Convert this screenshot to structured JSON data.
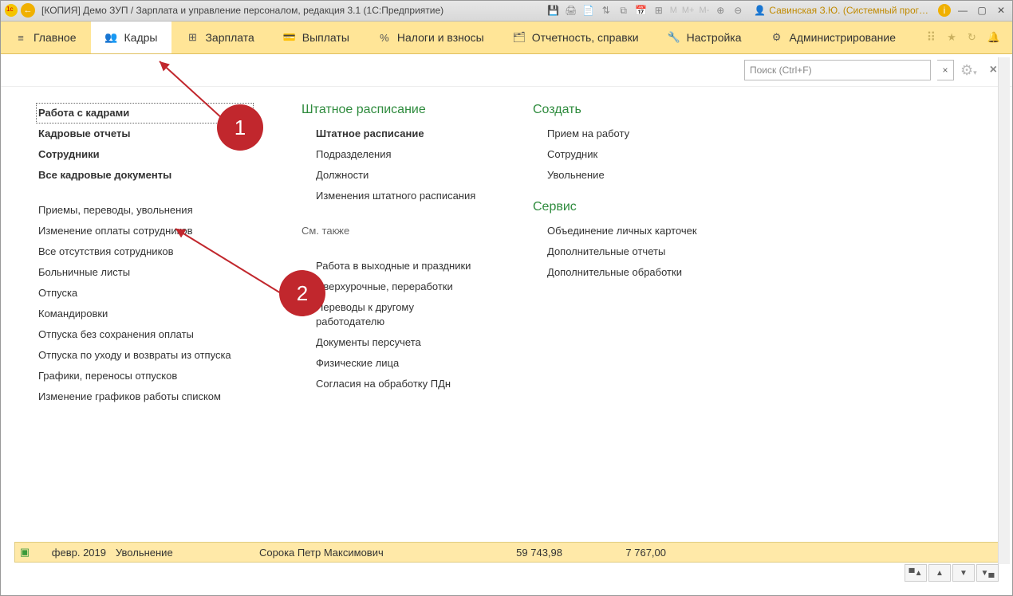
{
  "titlebar": {
    "title": "[КОПИЯ] Демо ЗУП / Зарплата и управление персоналом, редакция 3.1  (1С:Предприятие)",
    "m": "M",
    "mplus": "M+",
    "mminus": "M-",
    "user": "Савинская З.Ю. (Системный прог…"
  },
  "menu": {
    "items": [
      {
        "label": "Главное",
        "icon": "≡"
      },
      {
        "label": "Кадры",
        "icon": "👥",
        "active": true
      },
      {
        "label": "Зарплата",
        "icon": "⊞"
      },
      {
        "label": "Выплаты",
        "icon": "💳"
      },
      {
        "label": "Налоги и взносы",
        "icon": "%"
      },
      {
        "label": "Отчетность, справки",
        "icon": "🗂"
      },
      {
        "label": "Настройка",
        "icon": "🔧"
      },
      {
        "label": "Администрирование",
        "icon": "⚙"
      }
    ]
  },
  "search": {
    "placeholder": "Поиск (Ctrl+F)"
  },
  "col1": {
    "groupA": [
      {
        "label": "Работа с кадрами",
        "bold": true,
        "selected": true
      },
      {
        "label": "Кадровые отчеты",
        "bold": true
      },
      {
        "label": "Сотрудники",
        "bold": true
      },
      {
        "label": "Все кадровые документы",
        "bold": true
      }
    ],
    "groupB": [
      {
        "label": "Приемы, переводы, увольнения"
      },
      {
        "label": "Изменение оплаты сотрудников"
      },
      {
        "label": "Все отсутствия сотрудников"
      },
      {
        "label": "Больничные листы"
      },
      {
        "label": "Отпуска"
      },
      {
        "label": "Командировки"
      },
      {
        "label": "Отпуска без сохранения оплаты"
      },
      {
        "label": "Отпуска по уходу и возвраты из отпуска"
      },
      {
        "label": "Графики, переносы отпусков"
      },
      {
        "label": "Изменение графиков работы списком"
      }
    ]
  },
  "col2": {
    "section": "Штатное расписание",
    "groupA": [
      {
        "label": "Штатное расписание",
        "bold": true
      },
      {
        "label": "Подразделения"
      },
      {
        "label": "Должности"
      },
      {
        "label": "Изменения штатного расписания"
      }
    ],
    "seealso": "См. также",
    "groupB": [
      {
        "label": "Работа в выходные и праздники"
      },
      {
        "label": "Сверхурочные, переработки"
      },
      {
        "label": "Переводы к другому работодателю"
      },
      {
        "label": "Документы персучета"
      },
      {
        "label": "Физические лица"
      },
      {
        "label": "Согласия на обработку ПДн"
      }
    ]
  },
  "col3": {
    "sectionA": "Создать",
    "groupA": [
      {
        "label": "Прием на работу"
      },
      {
        "label": "Сотрудник"
      },
      {
        "label": "Увольнение"
      }
    ],
    "sectionB": "Сервис",
    "groupB": [
      {
        "label": "Объединение личных карточек"
      },
      {
        "label": "Дополнительные отчеты"
      },
      {
        "label": "Дополнительные обработки"
      }
    ]
  },
  "badges": {
    "one": "1",
    "two": "2"
  },
  "row": {
    "date": "февр. 2019",
    "type": "Увольнение",
    "person": "Сорока Петр Максимович",
    "sum1": "59 743,98",
    "sum2": "7 767,00"
  }
}
